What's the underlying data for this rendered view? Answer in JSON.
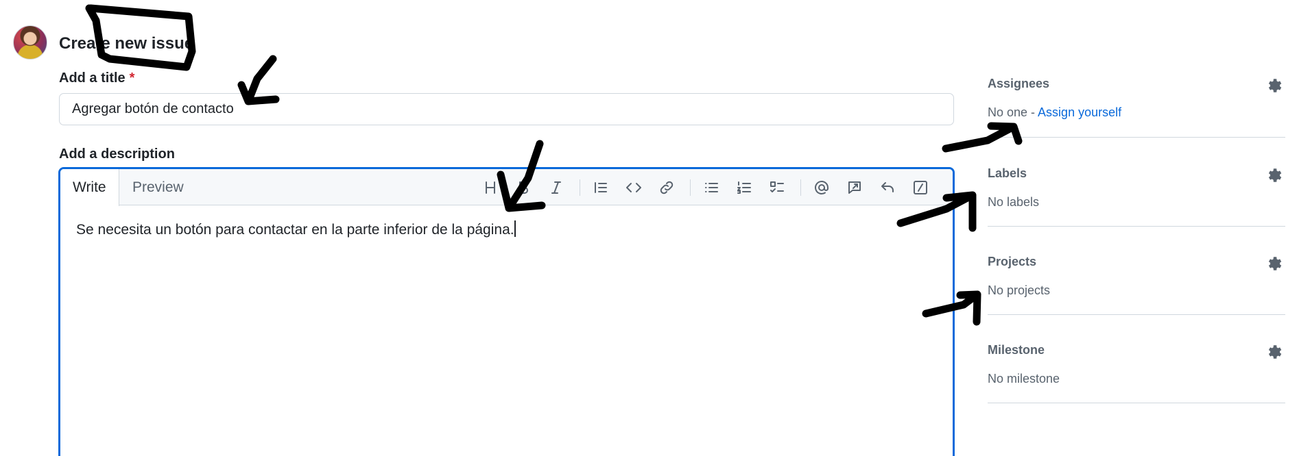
{
  "page": {
    "title": "Create new issue"
  },
  "form": {
    "title_label": "Add a title",
    "required_mark": "*",
    "title_value": "Agregar botón de contacto",
    "description_label": "Add a description",
    "tabs": {
      "write": "Write",
      "preview": "Preview"
    },
    "toolbar_icons": [
      "heading-icon",
      "bold-icon",
      "italic-icon",
      "quote-icon",
      "code-icon",
      "link-icon",
      "unordered-list-icon",
      "ordered-list-icon",
      "task-list-icon",
      "mention-icon",
      "reference-icon",
      "undo-icon",
      "slash-command-icon"
    ],
    "description_value": "Se necesita un botón para contactar en la parte inferior de la página."
  },
  "sidebar": {
    "assignees": {
      "heading": "Assignees",
      "value_prefix": "No one - ",
      "action": "Assign yourself"
    },
    "labels": {
      "heading": "Labels",
      "value": "No labels"
    },
    "projects": {
      "heading": "Projects",
      "value": "No projects"
    },
    "milestone": {
      "heading": "Milestone",
      "value": "No milestone"
    }
  },
  "colors": {
    "accent": "#0969da",
    "required": "#d1242f",
    "muted_text": "#59636e",
    "border": "#d0d7de",
    "annotation_ink": "#000000"
  }
}
